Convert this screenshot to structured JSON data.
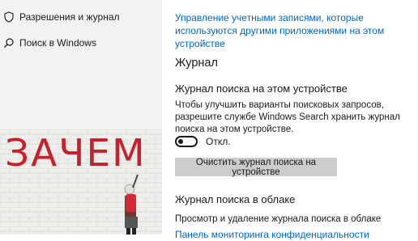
{
  "sidebar": {
    "items": [
      {
        "label": "Разрешения и журнал",
        "icon": "shield-icon"
      },
      {
        "label": "Поиск в Windows",
        "icon": "search-icon"
      }
    ],
    "wallpaper_text": "ЗАЧЕМ"
  },
  "main": {
    "accounts_link": "Управление учетными записями, которые используются другими приложениями на этом устройстве",
    "section_title": "Журнал",
    "device_history": {
      "heading": "Журнал поиска на этом устройстве",
      "description": "Чтобы улучшить варианты поисковых запросов, разрешите службе Windows Search хранить журнал поиска на этом устройстве.",
      "toggle_state": "Откл.",
      "clear_button": "Очистить журнал поиска на устройстве"
    },
    "cloud_history": {
      "heading": "Журнал поиска в облаке",
      "description": "Просмотр и удаление журнала поиска в облаке",
      "privacy_link": "Панель мониторинга конфиденциальности"
    }
  },
  "colors": {
    "accent_link": "#0067c0",
    "sidebar_bg": "#f2f2f2",
    "button_bg": "#cccccc",
    "graffiti_red": "#c8202a"
  }
}
